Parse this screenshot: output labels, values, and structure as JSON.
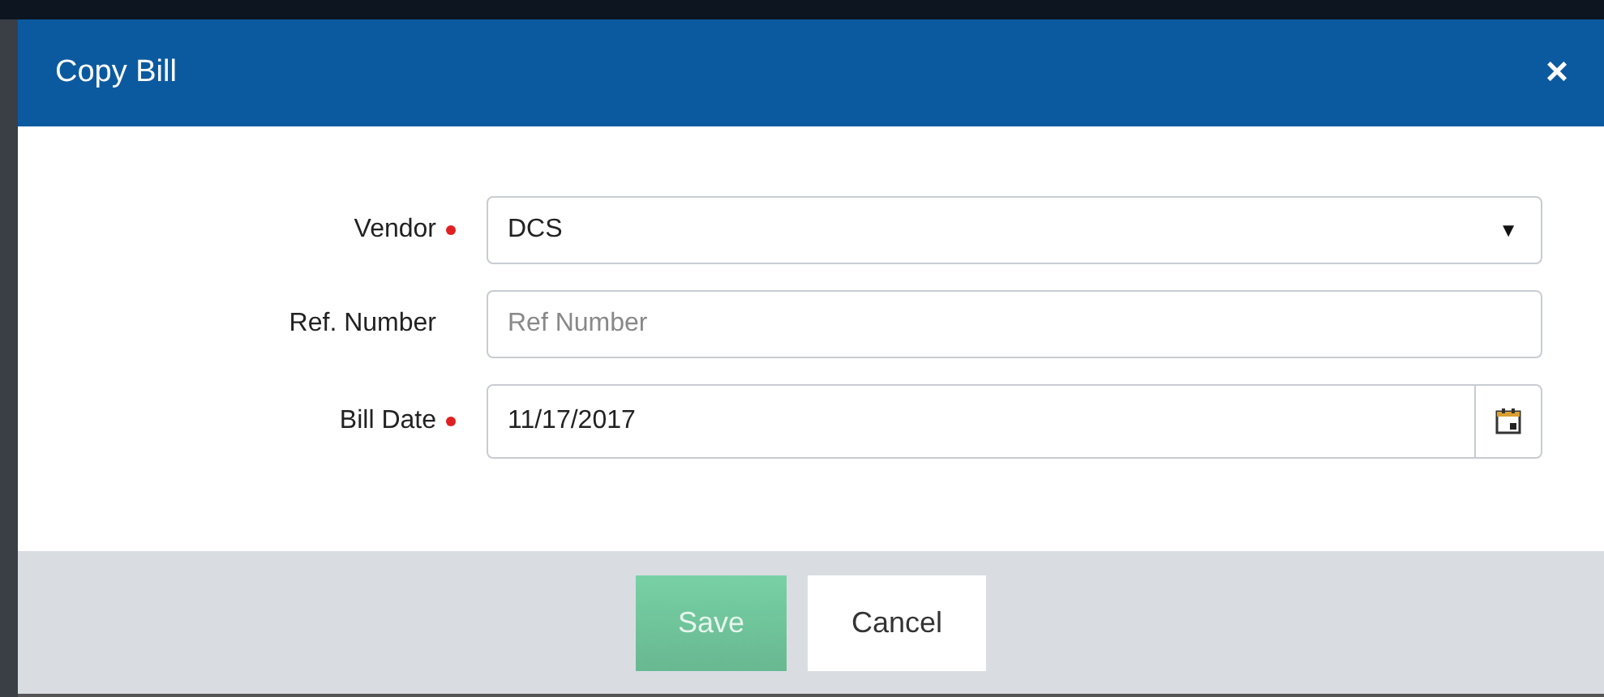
{
  "dialog": {
    "title": "Copy Bill",
    "close": "×"
  },
  "fields": [
    {
      "kind": "select",
      "label": "Vendor",
      "required": true,
      "value": "DCS",
      "caret": "▼"
    },
    {
      "kind": "text",
      "label": "Ref. Number",
      "required": false,
      "placeholder": "Ref Number"
    },
    {
      "kind": "date",
      "label": "Bill Date",
      "required": true,
      "value": "11/17/2017"
    }
  ],
  "buttons": [
    {
      "label": "Save",
      "kind": "primary",
      "disabled": true
    },
    {
      "label": "Cancel",
      "kind": "secondary",
      "disabled": false
    }
  ]
}
